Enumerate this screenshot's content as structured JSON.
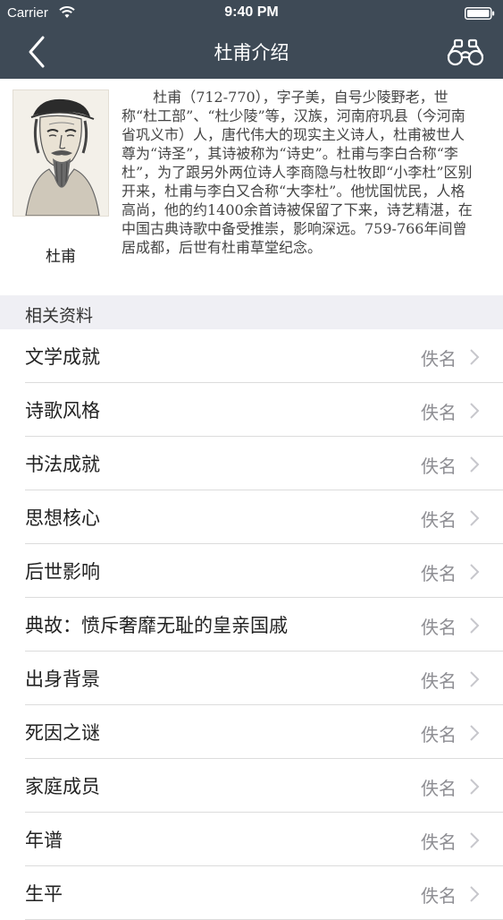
{
  "status": {
    "carrier": "Carrier",
    "time": "9:40 PM"
  },
  "nav": {
    "title": "杜甫介绍",
    "back_icon": "chevron-left-icon",
    "action_icon": "binoculars-icon"
  },
  "intro": {
    "portrait_caption": "杜甫",
    "bio": "杜甫（712-770），字子美，自号少陵野老，世称“杜工部”、“杜少陵”等，汉族，河南府巩县（今河南省巩义市）人，唐代伟大的现实主义诗人，杜甫被世人尊为“诗圣”，其诗被称为“诗史”。杜甫与李白合称“李杜”，为了跟另外两位诗人李商隐与杜牧即“小李杜”区别开来，杜甫与李白又合称“大李杜”。他忧国忧民，人格高尚，他的约1400余首诗被保留了下来，诗艺精湛，在中国古典诗歌中备受推崇，影响深远。759-766年间曾居成都，后世有杜甫草堂纪念。"
  },
  "section": {
    "title": "相关资料"
  },
  "items": [
    {
      "label": "文学成就",
      "detail": "佚名"
    },
    {
      "label": "诗歌风格",
      "detail": "佚名"
    },
    {
      "label": "书法成就",
      "detail": "佚名"
    },
    {
      "label": "思想核心",
      "detail": "佚名"
    },
    {
      "label": "后世影响",
      "detail": "佚名"
    },
    {
      "label": "典故：愤斥奢靡无耻的皇亲国戚",
      "detail": "佚名"
    },
    {
      "label": "出身背景",
      "detail": "佚名"
    },
    {
      "label": "死因之谜",
      "detail": "佚名"
    },
    {
      "label": "家庭成员",
      "detail": "佚名"
    },
    {
      "label": "年谱",
      "detail": "佚名"
    },
    {
      "label": "生平",
      "detail": "佚名"
    }
  ],
  "colors": {
    "navbar": "#3e4a56",
    "section_bg": "#efeff4",
    "detail_text": "#8e8e93"
  }
}
